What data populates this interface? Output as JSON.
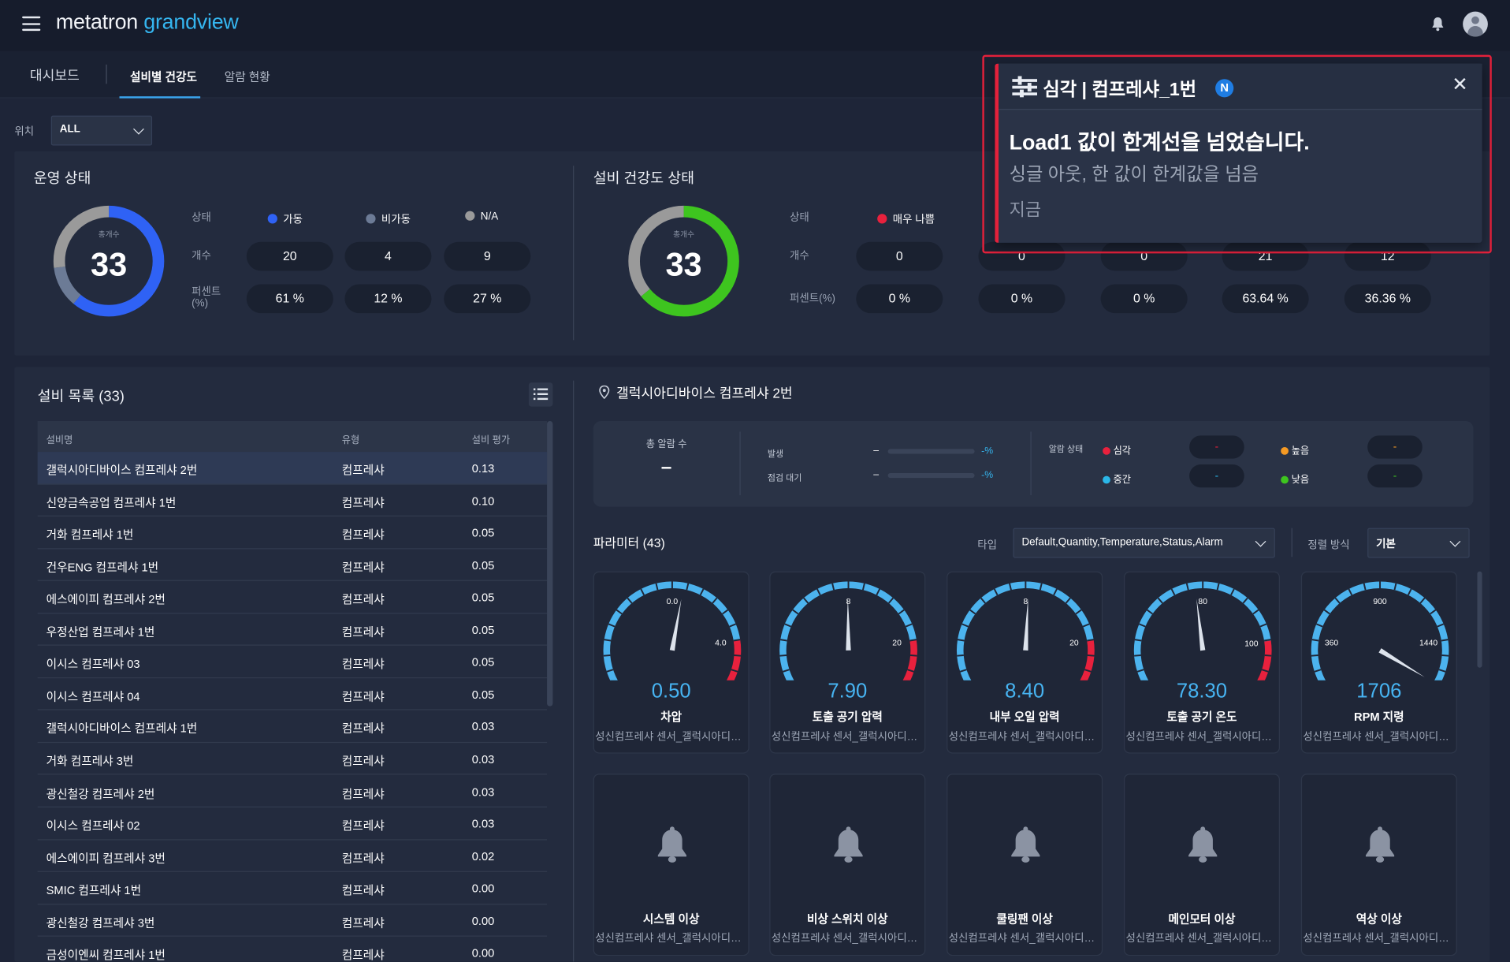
{
  "app": {
    "logo_main": "metatron ",
    "logo_accent": "grandview"
  },
  "tabs": [
    "대시보드",
    "설비별 건강도",
    "알람 현황"
  ],
  "filter": {
    "label": "위치",
    "value": "ALL"
  },
  "operation": {
    "title": "운영 상태",
    "total_label": "총개수",
    "total": "33",
    "row_labels": {
      "state": "상태",
      "count": "개수",
      "percent": "퍼센트\n(%)"
    },
    "states": [
      {
        "label": "가동",
        "count": "20",
        "percent": "61 %",
        "color": "#2f62f5",
        "fraction": 0.61
      },
      {
        "label": "비가동",
        "count": "4",
        "percent": "12 %",
        "color": "#6c7b96",
        "fraction": 0.12
      },
      {
        "label": "N/A",
        "count": "9",
        "percent": "27 %",
        "color": "#9a9a9a",
        "fraction": 0.27
      }
    ]
  },
  "health": {
    "title": "설비 건강도 상태",
    "total_label": "총개수",
    "total": "33",
    "row_labels": {
      "state": "상태",
      "count": "개수",
      "percent": "퍼센트(%)"
    },
    "states": [
      {
        "label": "매우 나쁨",
        "count": "0",
        "percent": "0 %",
        "color": "#e8213d"
      },
      {
        "label": "",
        "count": "0",
        "percent": "0 %"
      },
      {
        "label": "",
        "count": "0",
        "percent": "0 %"
      },
      {
        "label": "",
        "count": "21",
        "percent": "63.64 %"
      },
      {
        "label": "",
        "count": "12",
        "percent": "36.36 %"
      }
    ],
    "ring": {
      "good_fraction": 0.64,
      "good_color": "#3ec51f",
      "rest_color": "#9a9a9a"
    }
  },
  "equipment_list": {
    "title": "설비 목록 (33)",
    "columns": [
      "설비명",
      "유형",
      "설비 평가"
    ],
    "rows": [
      [
        "갤럭시아디바이스 컴프레샤 2번",
        "컴프레샤",
        "0.13"
      ],
      [
        "신양금속공업 컴프레샤 1번",
        "컴프레샤",
        "0.10"
      ],
      [
        "거화 컴프레샤 1번",
        "컴프레샤",
        "0.05"
      ],
      [
        "건우ENG 컴프레샤 1번",
        "컴프레샤",
        "0.05"
      ],
      [
        "에스에이피 컴프레샤 2번",
        "컴프레샤",
        "0.05"
      ],
      [
        "우정산업 컴프레샤 1번",
        "컴프레샤",
        "0.05"
      ],
      [
        "이시스 컴프레샤 03",
        "컴프레샤",
        "0.05"
      ],
      [
        "이시스 컴프레샤 04",
        "컴프레샤",
        "0.05"
      ],
      [
        "갤럭시아디바이스 컴프레샤 1번",
        "컴프레샤",
        "0.03"
      ],
      [
        "거화 컴프레샤 3번",
        "컴프레샤",
        "0.03"
      ],
      [
        "광신철강 컴프레샤 2번",
        "컴프레샤",
        "0.03"
      ],
      [
        "이시스 컴프레샤 02",
        "컴프레샤",
        "0.03"
      ],
      [
        "에스에이피 컴프레샤 3번",
        "컴프레샤",
        "0.02"
      ],
      [
        "SMIC 컴프레샤 1번",
        "컴프레샤",
        "0.00"
      ],
      [
        "광신철강 컴프레샤 3번",
        "컴프레샤",
        "0.00"
      ],
      [
        "금성이엔씨 컴프레샤 1번",
        "컴프레샤",
        "0.00"
      ]
    ]
  },
  "detail": {
    "title": "갤럭시아디바이스 컴프레샤 2번",
    "alarm_total_label": "총 알람 수",
    "alarm_total": "–",
    "progress": [
      {
        "label": "발생",
        "value": "–",
        "pct": "-%"
      },
      {
        "label": "점검 대기",
        "value": "–",
        "pct": "-%"
      }
    ],
    "alarm_state_label": "알람 상태",
    "alarm_states": [
      {
        "label": "심각",
        "value": "-",
        "color": "#e8213d"
      },
      {
        "label": "높음",
        "value": "-",
        "color": "#f59a23"
      },
      {
        "label": "중간",
        "value": "-",
        "color": "#2bb7e8"
      },
      {
        "label": "낮음",
        "value": "-",
        "color": "#3ec51f"
      }
    ]
  },
  "parameters": {
    "title": "파라미터 (43)",
    "type_label": "타입",
    "type_value": "Default,Quantity,Temperature,Status,Alarm",
    "sort_label": "정렬 방식",
    "sort_value": "기본",
    "gauges": [
      {
        "value": "0.50",
        "name": "차압",
        "source": "성신컴프레샤 센서_갤럭시아디바이스",
        "min": -6.7,
        "max": 6.7,
        "v": 0.5,
        "labels": [
          "-6.7",
          "0.0",
          "4.0",
          "6.7"
        ],
        "red_from": 4.0
      },
      {
        "value": "7.90",
        "name": "토출 공기 압력",
        "source": "성신컴프레샤 센서_갤럭시아디바이스",
        "min": -12,
        "max": 28,
        "v": 7.9,
        "labels": [
          "-12",
          "8",
          "20",
          "28"
        ],
        "red_from": 20
      },
      {
        "value": "8.40",
        "name": "내부 오일 압력",
        "source": "성신컴프레샤 센서_갤럭시아디바이스",
        "min": -12,
        "max": 28,
        "v": 8.4,
        "labels": [
          "-12",
          "8",
          "20",
          "28"
        ],
        "red_from": 20
      },
      {
        "value": "78.30",
        "name": "토출 공기 온도",
        "source": "성신컴프레샤 센서_갤럭시아디바이스",
        "min": 47,
        "max": 113,
        "v": 78.3,
        "labels": [
          "47",
          "80",
          "100",
          "113"
        ],
        "red_from": 100
      },
      {
        "value": "1706",
        "name": "RPM 지령",
        "source": "성신컴프레샤 센서_갤럭시아디바이스",
        "min": 0,
        "max": 1800,
        "v": 1706,
        "labels": [
          "0",
          "360",
          "900",
          "1440",
          "1800"
        ],
        "red_from": null
      }
    ],
    "alarms": [
      {
        "name": "시스템 이상",
        "source": "성신컴프레샤 센서_갤럭시아디바이스"
      },
      {
        "name": "비상 스위치 이상",
        "source": "성신컴프레샤 센서_갤럭시아디바이스"
      },
      {
        "name": "쿨링팬 이상",
        "source": "성신컴프레샤 센서_갤럭시아디바이스"
      },
      {
        "name": "메인모터 이상",
        "source": "성신컴프레샤 센서_갤럭시아디바이스"
      },
      {
        "name": "역상 이상",
        "source": "성신컴프레샤 센서_갤럭시아디바이스"
      }
    ]
  },
  "toast": {
    "severity": "심각",
    "separator": "|",
    "equipment": "컴프레샤_1번",
    "badge": "N",
    "message": "Load1 값이 한계선을 넘었습니다.",
    "detail": "싱글 아웃, 한 값이 한계값을 넘음",
    "time": "지금",
    "close_label": "✕"
  },
  "colors": {
    "accent": "#35b6f0",
    "critical": "#e8213d",
    "gauge_blue": "#4cb3ee",
    "gauge_red": "#e8213d"
  }
}
